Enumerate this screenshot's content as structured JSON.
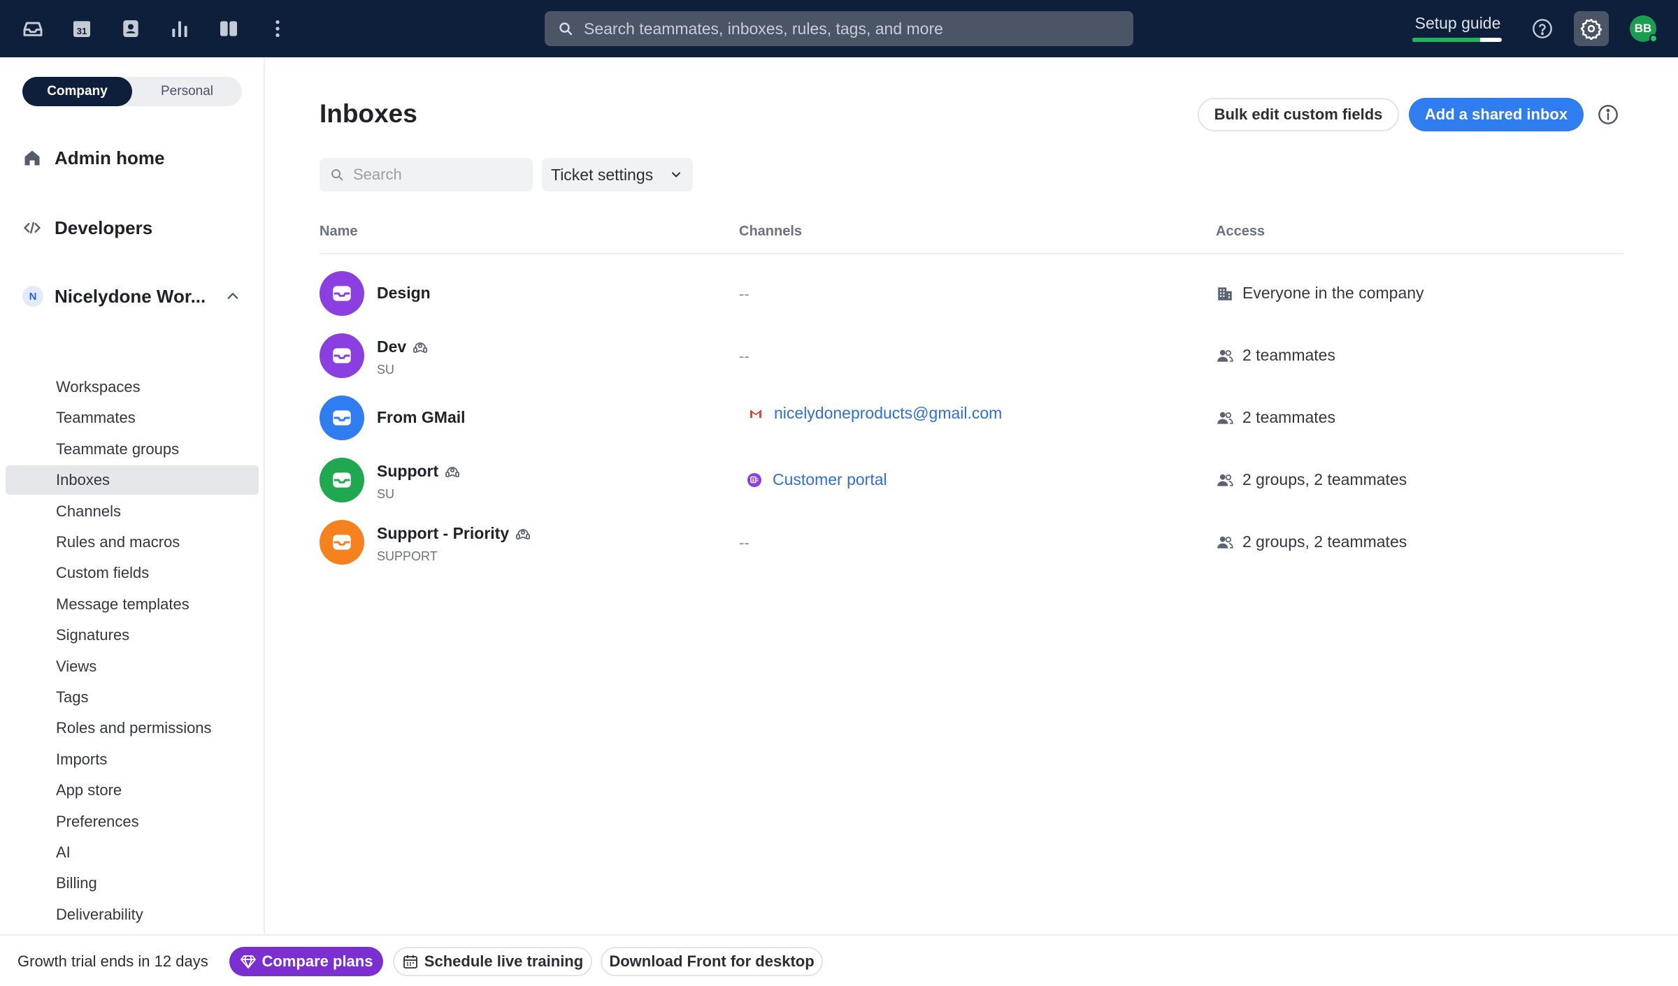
{
  "topbar": {
    "nav_icons": [
      "inbox-icon",
      "calendar-icon",
      "contacts-icon",
      "analytics-icon",
      "knowledge-base-icon",
      "more-icon"
    ],
    "calendar_day": "31",
    "search_placeholder": "Search teammates, inboxes, rules, tags, and more",
    "setup_guide_label": "Setup guide",
    "setup_guide_progress": 0.76,
    "user_initials": "BB"
  },
  "sidebar": {
    "scope_tabs": {
      "active": "Company",
      "inactive": "Personal"
    },
    "admin_home": "Admin home",
    "developers": "Developers",
    "workspace": {
      "badge": "N",
      "name": "Nicelydone Wor..."
    },
    "items": [
      "Workspaces",
      "Teammates",
      "Teammate groups",
      "Inboxes",
      "Channels",
      "Rules and macros",
      "Custom fields",
      "Message templates",
      "Signatures",
      "Views",
      "Tags",
      "Roles and permissions",
      "Imports",
      "App store",
      "Preferences",
      "AI",
      "Billing",
      "Deliverability"
    ],
    "selected_item": "Inboxes"
  },
  "main": {
    "title": "Inboxes",
    "bulk_edit_label": "Bulk edit custom fields",
    "add_inbox_label": "Add a shared inbox",
    "search_placeholder": "Search",
    "ticket_settings_label": "Ticket settings",
    "columns": {
      "name": "Name",
      "channels": "Channels",
      "access": "Access"
    },
    "inboxes": [
      {
        "name": "Design",
        "sub": "",
        "color": "#8b3fe0",
        "shared_icon": false,
        "channel": "--",
        "channel_type": "none",
        "access": "Everyone in the company",
        "access_icon": "building-icon"
      },
      {
        "name": "Dev",
        "sub": "SU",
        "color": "#8b3fe0",
        "shared_icon": true,
        "channel": "--",
        "channel_type": "none",
        "access": "2 teammates",
        "access_icon": "people-icon"
      },
      {
        "name": "From GMail",
        "sub": "",
        "color": "#2f7df0",
        "shared_icon": false,
        "channel": "nicelydoneproducts@gmail.com",
        "channel_type": "gmail",
        "access": "2 teammates",
        "access_icon": "people-icon"
      },
      {
        "name": "Support",
        "sub": "SU",
        "color": "#1fa84f",
        "shared_icon": true,
        "channel": "Customer portal",
        "channel_type": "portal",
        "access": "2 groups, 2 teammates",
        "access_icon": "people-icon"
      },
      {
        "name": "Support - Priority",
        "sub": "SUPPORT",
        "color": "#f5821f",
        "shared_icon": true,
        "channel": "--",
        "channel_type": "none",
        "access": "2 groups, 2 teammates",
        "access_icon": "people-icon"
      }
    ]
  },
  "footer": {
    "trial_text": "Growth trial ends in 12 days",
    "compare_plans": "Compare plans",
    "schedule_training": "Schedule live training",
    "download_desktop": "Download Front for desktop"
  }
}
